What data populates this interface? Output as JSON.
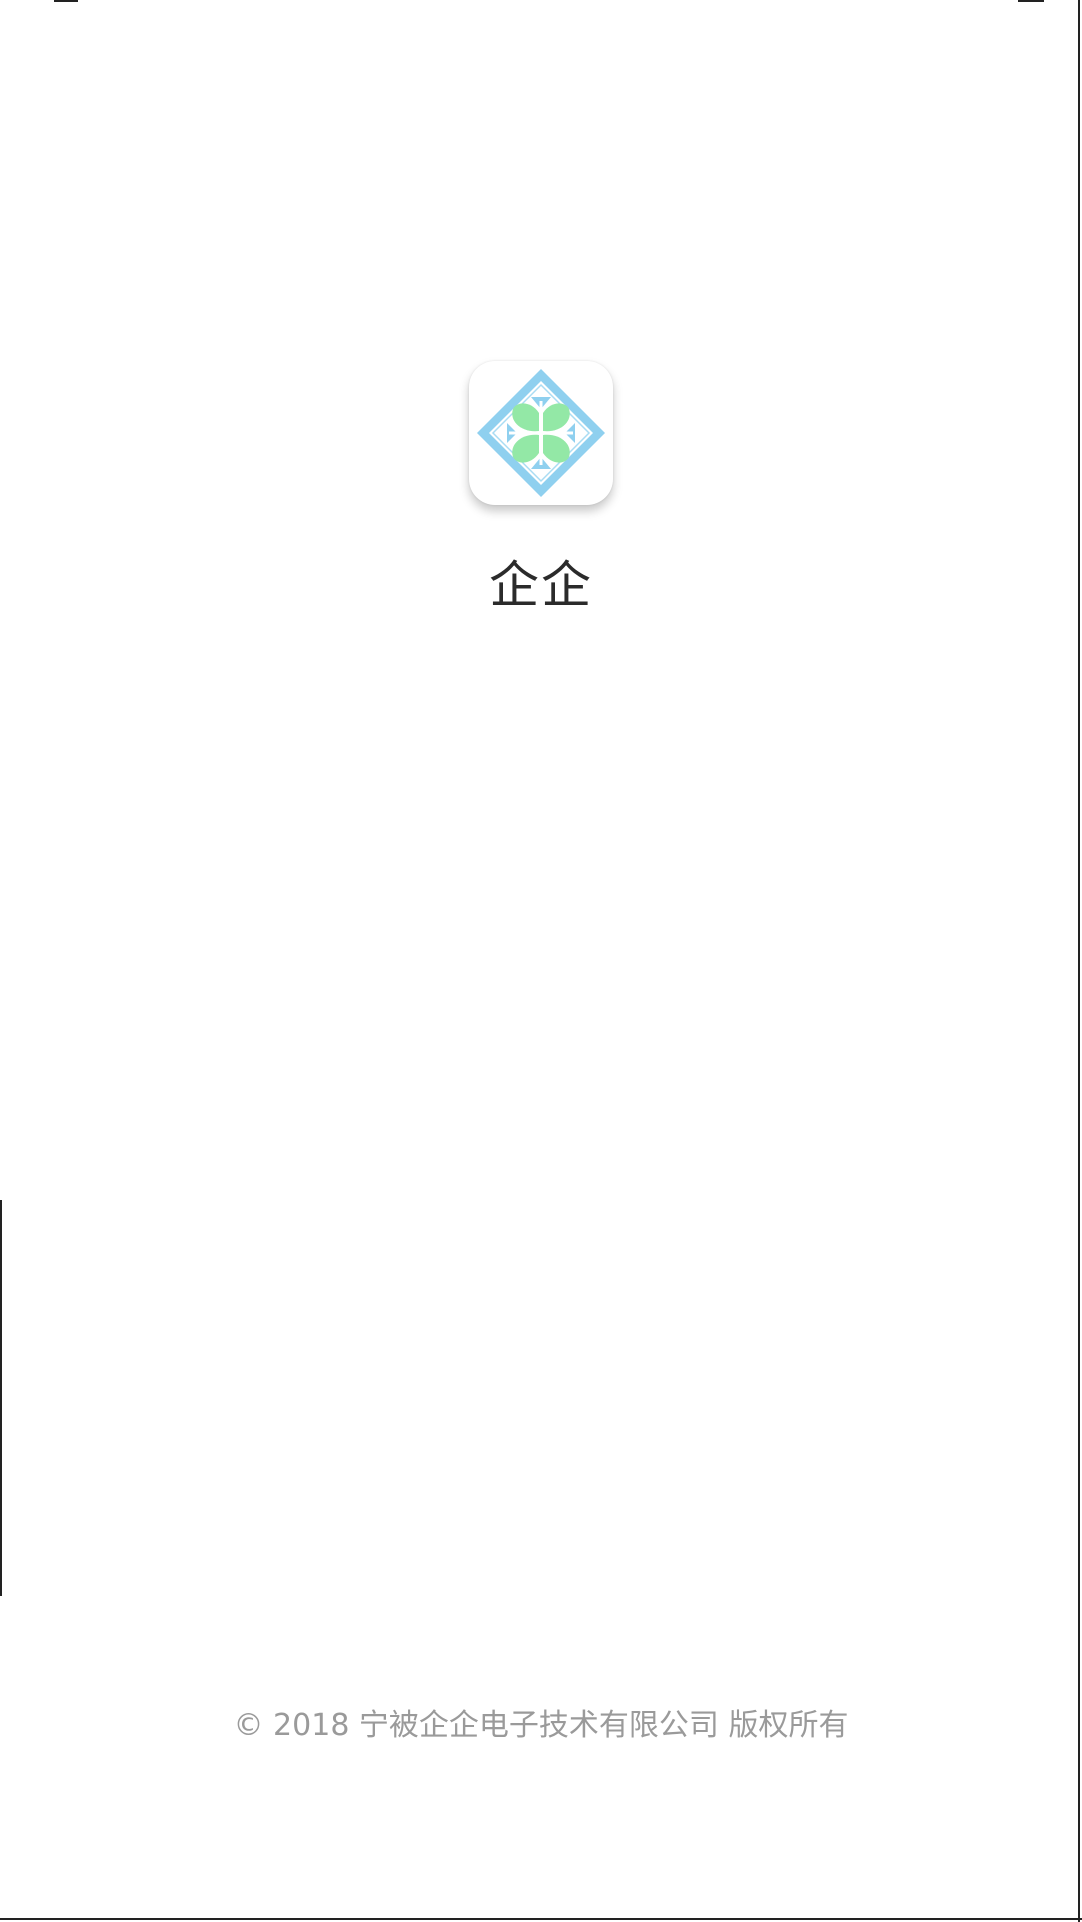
{
  "app": {
    "name": "企企",
    "icon": "clover-diamond-logo-icon"
  },
  "footer": {
    "copyright": "© 2018 宁被企企电子技术有限公司 版权所有"
  },
  "colors": {
    "background": "#ffffff",
    "diamond_blue": "#8fd0ef",
    "clover_green": "#93e8a6",
    "title_text": "#2b2b2b",
    "footer_text": "#9a9a9a"
  }
}
